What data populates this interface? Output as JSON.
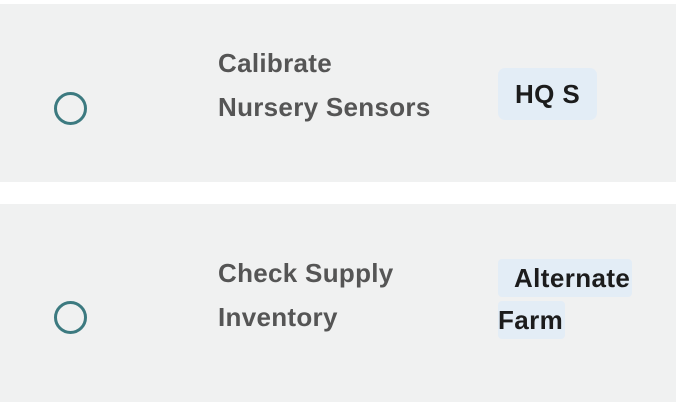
{
  "tasks": [
    {
      "title_line1": "Calibrate",
      "title_line2": "Nursery Sensors",
      "location": "HQ S"
    },
    {
      "title_line1": "Check Supply",
      "title_line2": "Inventory",
      "location_line1": "Alternate",
      "location_line2": "Farm"
    }
  ],
  "colors": {
    "row_background": "#f0f1f1",
    "checkbox_border": "#3c7a80",
    "tag_background": "#e3edf6",
    "title_text": "#555555",
    "tag_text": "#1c1c1c"
  }
}
